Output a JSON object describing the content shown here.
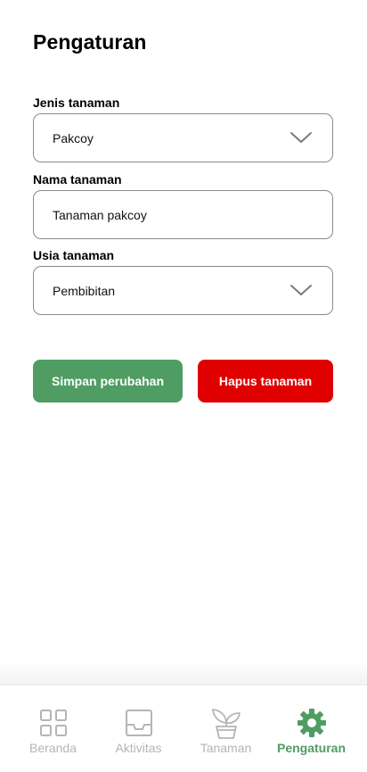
{
  "page": {
    "title": "Pengaturan"
  },
  "form": {
    "jenis": {
      "label": "Jenis tanaman",
      "value": "Pakcoy",
      "icon": "chevron-down-icon"
    },
    "nama": {
      "label": "Nama tanaman",
      "value": "Tanaman pakcoy"
    },
    "usia": {
      "label": "Usia tanaman",
      "value": "Pembibitan",
      "icon": "chevron-down-icon"
    }
  },
  "actions": {
    "save_label": "Simpan perubahan",
    "delete_label": "Hapus tanaman",
    "save_color": "#4f9d63",
    "delete_color": "#e00000"
  },
  "bottom_nav": {
    "active_color": "#4f9d63",
    "inactive_color": "#b5b5b5",
    "items": [
      {
        "label": "Beranda",
        "icon": "grid-icon",
        "active": false
      },
      {
        "label": "Aktivitas",
        "icon": "inbox-icon",
        "active": false
      },
      {
        "label": "Tanaman",
        "icon": "plant-icon",
        "active": false
      },
      {
        "label": "Pengaturan",
        "icon": "gear-icon",
        "active": true
      }
    ]
  }
}
